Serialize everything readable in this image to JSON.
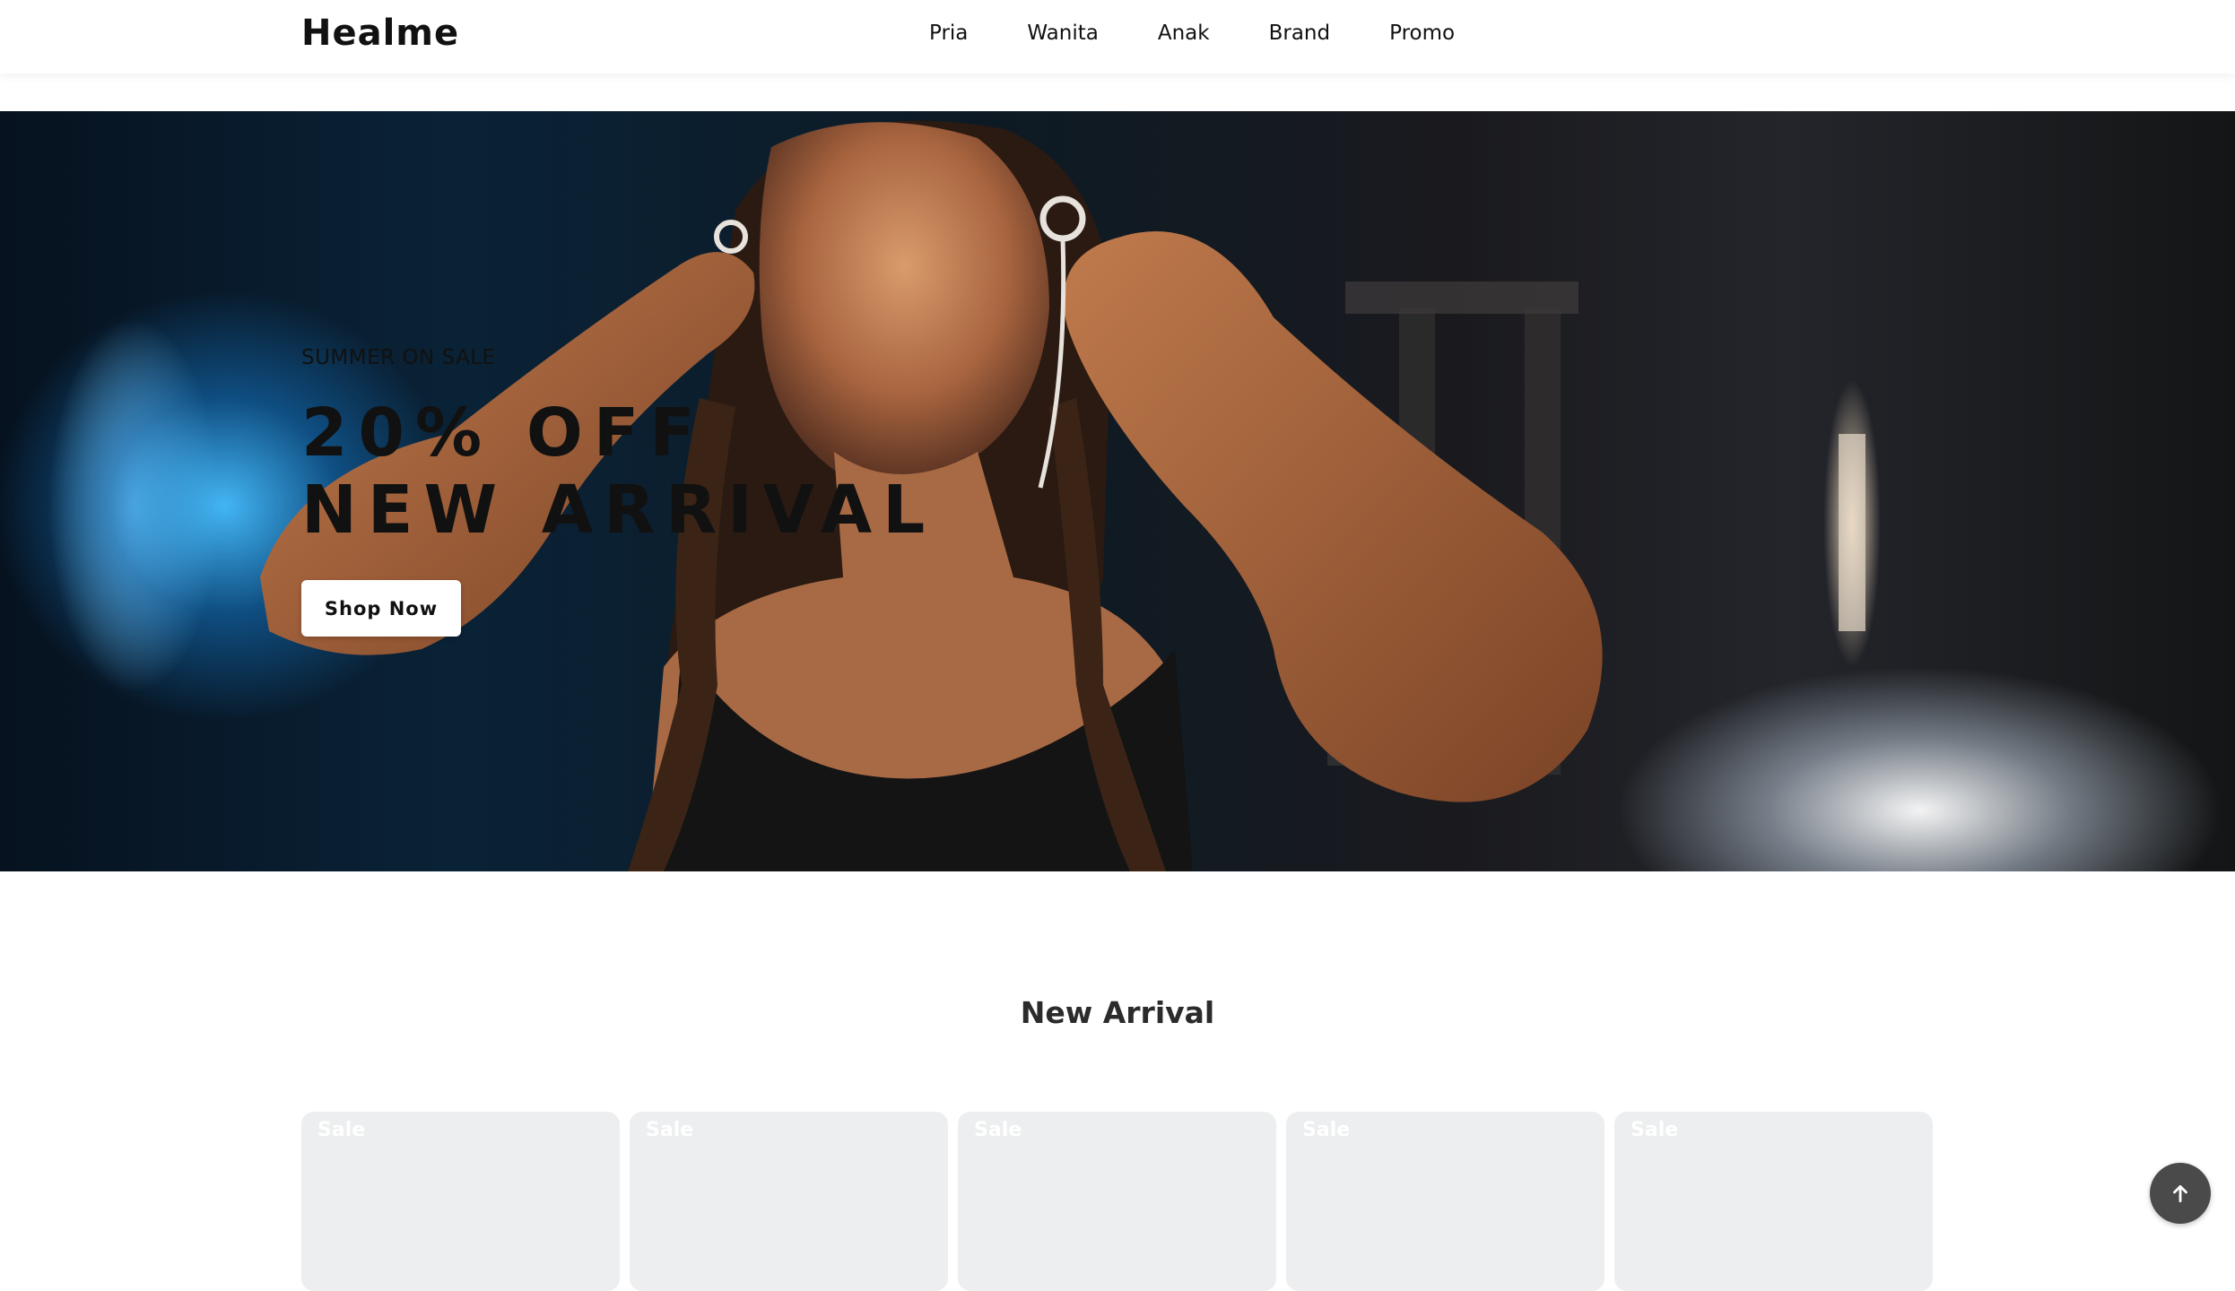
{
  "header": {
    "logo": "Healme",
    "nav": [
      "Pria",
      "Wanita",
      "Anak",
      "Brand",
      "Promo"
    ]
  },
  "hero": {
    "eyebrow": "SUMMER ON SALE",
    "title_line1": "20% OFF",
    "title_line2": "NEW ARRIVAL",
    "button_label": "Shop Now"
  },
  "new_arrival": {
    "title": "New Arrival",
    "cards": [
      {
        "badge": "Sale"
      },
      {
        "badge": "Sale"
      },
      {
        "badge": "Sale"
      },
      {
        "badge": "Sale"
      },
      {
        "badge": "Sale"
      }
    ]
  },
  "colors": {
    "card_bg": "#eceeef",
    "to_top_bg": "#4a4a4a",
    "text": "#111111"
  },
  "icons": {
    "to_top": "arrow-up-icon"
  }
}
